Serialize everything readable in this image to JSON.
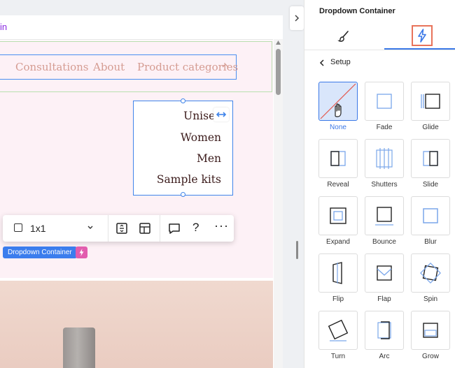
{
  "site": {
    "url_fragment": "in",
    "menu": {
      "items": [
        "Consultations",
        "About",
        "Product categories"
      ]
    },
    "dropdown": {
      "items": [
        "Unisex",
        "Women",
        "Men",
        "Sample kits"
      ]
    },
    "toolbar": {
      "ratio_value": "1x1",
      "help_label": "?",
      "more_label": "···"
    },
    "selection_tag": "Dropdown Container"
  },
  "panel": {
    "title": "Dropdown Container",
    "tabs": [
      {
        "name": "Design",
        "icon": "paintbrush-icon"
      },
      {
        "name": "Animation",
        "icon": "lightning-icon",
        "active": true
      }
    ],
    "back_label": "Setup",
    "animations": [
      {
        "label": "None",
        "selected": true
      },
      {
        "label": "Fade"
      },
      {
        "label": "Glide"
      },
      {
        "label": "Reveal"
      },
      {
        "label": "Shutters"
      },
      {
        "label": "Slide"
      },
      {
        "label": "Expand"
      },
      {
        "label": "Bounce"
      },
      {
        "label": "Blur"
      },
      {
        "label": "Flip"
      },
      {
        "label": "Flap"
      },
      {
        "label": "Spin"
      },
      {
        "label": "Turn"
      },
      {
        "label": "Arc"
      },
      {
        "label": "Grow"
      }
    ]
  },
  "colors": {
    "accent": "#3a78e7",
    "highlight": "#e8735a",
    "menu_text": "#d59c92",
    "dropdown_text": "#3b1b1b",
    "tag_blue": "#3b7ded",
    "tag_pink": "#e25dae"
  }
}
